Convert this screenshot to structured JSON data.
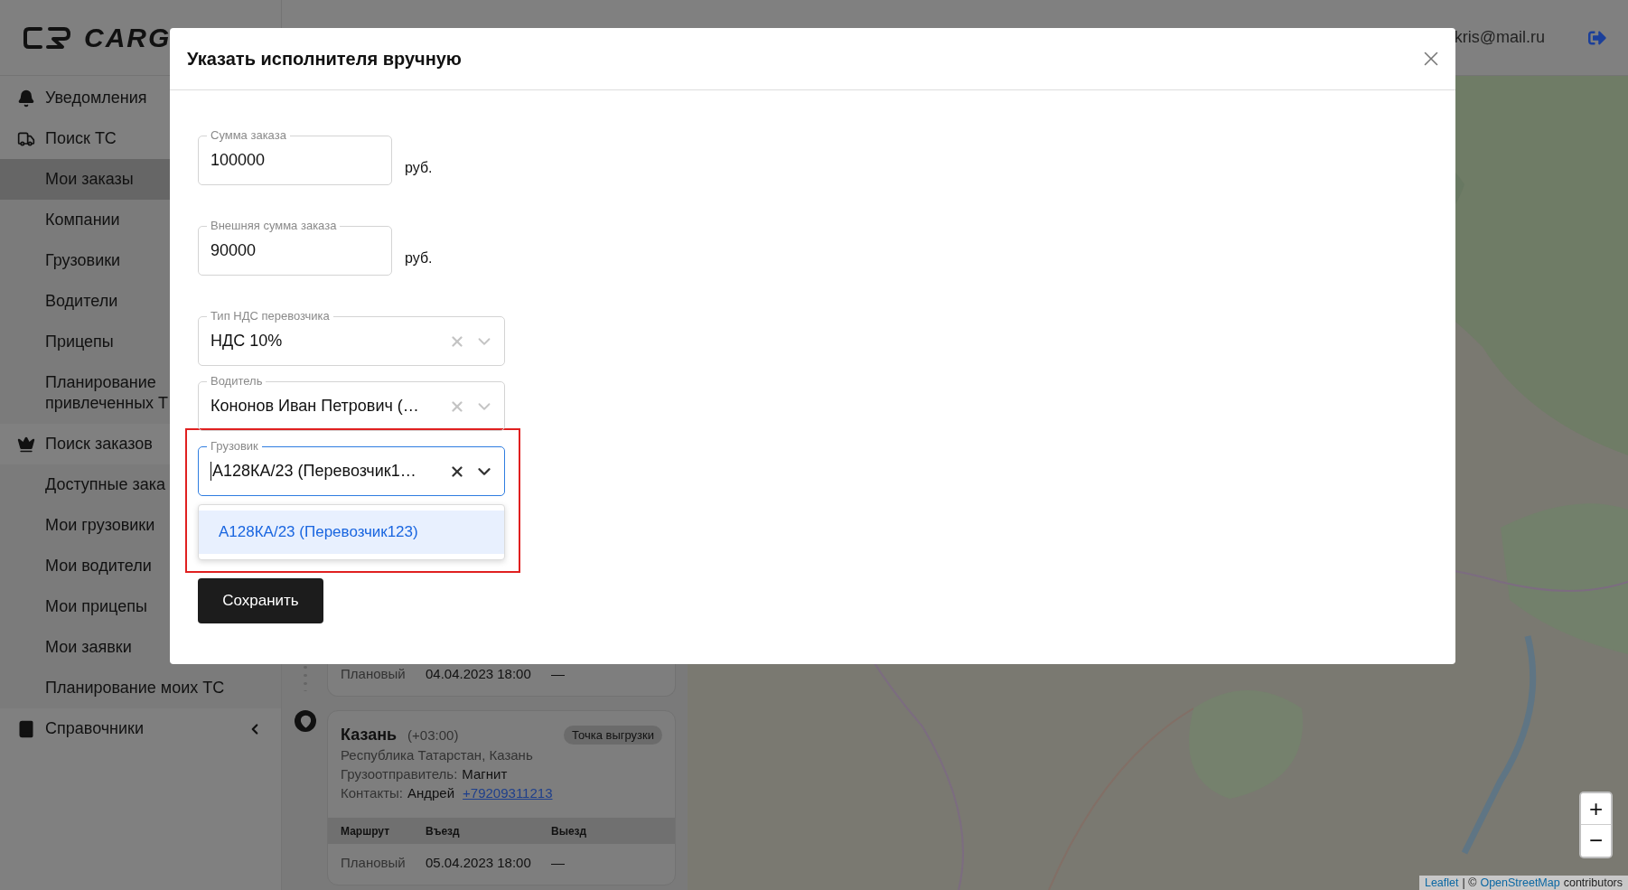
{
  "header": {
    "logo_text": "CARG",
    "user_email": "kris@mail.ru"
  },
  "sidebar": {
    "items": [
      {
        "label": "Уведомления",
        "kind": "bell",
        "selected": false
      },
      {
        "label": "Поиск ТС",
        "kind": "truck",
        "selected": false,
        "children": [
          {
            "label": "Мои заказы",
            "selected": true
          },
          {
            "label": "Компании",
            "selected": false
          },
          {
            "label": "Грузовики",
            "selected": false
          },
          {
            "label": "Водители",
            "selected": false
          },
          {
            "label": "Прицепы",
            "selected": false
          },
          {
            "label": "Планирование\nпривлеченных Т",
            "selected": false
          }
        ]
      },
      {
        "label": "Поиск заказов",
        "kind": "crown",
        "selected": false,
        "children": [
          {
            "label": "Доступные зака",
            "selected": false
          },
          {
            "label": "Мои грузовики",
            "selected": false
          },
          {
            "label": "Мои водители",
            "selected": false
          },
          {
            "label": "Мои прицепы",
            "selected": false
          },
          {
            "label": "Мои заявки",
            "selected": false
          },
          {
            "label": "Планирование моих ТС",
            "selected": false
          }
        ]
      },
      {
        "label": "Справочники",
        "kind": "book",
        "selected": false,
        "expanded": false
      }
    ]
  },
  "route": {
    "cards": [
      {
        "kind": "partial",
        "rows": [
          [
            "Плановый",
            "04.04.2023 18:00",
            "—"
          ]
        ]
      },
      {
        "kind": "full",
        "city": "Казань",
        "timezone": "(+03:00)",
        "badge": "Точка выгрузки",
        "address": "Республика Татарстан, Казань",
        "shipper_label": "Грузоотправитель:",
        "shipper": "Магнит",
        "contacts_label": "Контакты:",
        "contact_name": "Андрей",
        "phone": "+79209311213",
        "columns": [
          "Маршрут",
          "Въезд",
          "Выезд"
        ],
        "rows": [
          [
            "Плановый",
            "05.04.2023 18:00",
            "—"
          ]
        ]
      }
    ]
  },
  "map": {
    "zoom_in": "+",
    "zoom_out": "−",
    "attribution": [
      {
        "text": "Leaflet",
        "link": true
      },
      {
        "text": "| ©",
        "link": false
      },
      {
        "text": "OpenStreetMap",
        "link": true
      },
      {
        "text": "contributors",
        "link": false
      }
    ]
  },
  "modal": {
    "title": "Указать исполнителя вручную",
    "fields": [
      {
        "kind": "amount",
        "label": "Сумма заказа",
        "value": "100000",
        "unit": "руб."
      },
      {
        "kind": "amount",
        "label": "Внешняя сумма заказа",
        "value": "90000",
        "unit": "руб."
      },
      {
        "kind": "select",
        "label": "Тип НДС перевозчика",
        "value": "НДС 10%",
        "focused": false,
        "highlighted": false
      },
      {
        "kind": "select",
        "label": "Водитель",
        "value": "Кононов Иван Петрович (…",
        "focused": false,
        "highlighted": false
      },
      {
        "kind": "select",
        "label": "Грузовик",
        "value": "А128КА/23 (Перевозчик1…",
        "focused": true,
        "highlighted": true,
        "options": [
          {
            "label": "А128КА/23 (Перевозчик123)",
            "selected": true
          }
        ]
      }
    ],
    "save_button": "Сохранить"
  }
}
